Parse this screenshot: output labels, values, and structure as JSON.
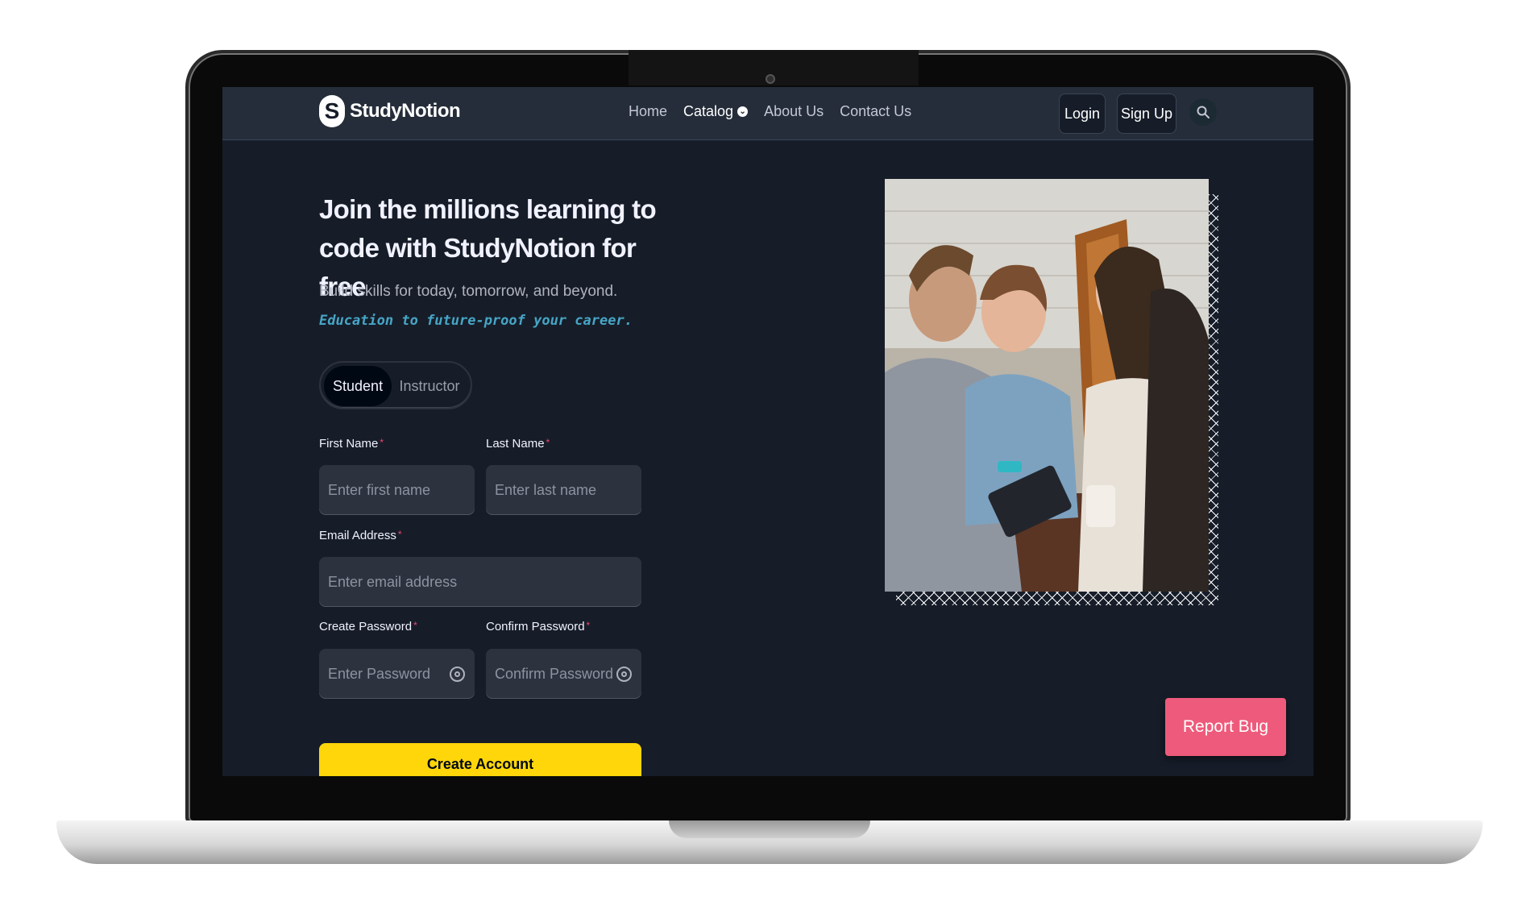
{
  "brand": {
    "logo_letter": "S",
    "name": "StudyNotion"
  },
  "nav": {
    "links": [
      {
        "label": "Home"
      },
      {
        "label": "Catalog"
      },
      {
        "label": "About Us"
      },
      {
        "label": "Contact Us"
      }
    ],
    "login_label": "Login",
    "signup_label": "Sign Up",
    "search_icon": "search-icon"
  },
  "hero": {
    "heading": "Join the millions learning to code with StudyNotion for free",
    "subtitle": "Build skills for today, tomorrow, and beyond.",
    "subtitle_accent": "Education to future-proof your career."
  },
  "tabs": [
    {
      "label": "Student",
      "active": true
    },
    {
      "label": "Instructor",
      "active": false
    }
  ],
  "form": {
    "required_mark": "*",
    "first_name": {
      "label": "First Name",
      "placeholder": "Enter first name"
    },
    "last_name": {
      "label": "Last Name",
      "placeholder": "Enter last name"
    },
    "email": {
      "label": "Email Address",
      "placeholder": "Enter email address"
    },
    "password": {
      "label": "Create Password",
      "placeholder": "Enter Password"
    },
    "confirm_password": {
      "label": "Confirm Password",
      "placeholder": "Confirm Password"
    },
    "submit_label": "Create Account"
  },
  "report_bug_label": "Report Bug",
  "colors": {
    "background": "#161d29",
    "navbar": "#252d3a",
    "accent_yellow": "#ffd60a",
    "accent_blue": "#47a5c5",
    "required_red": "#ef476f",
    "report_pink": "#ee5a7b"
  }
}
